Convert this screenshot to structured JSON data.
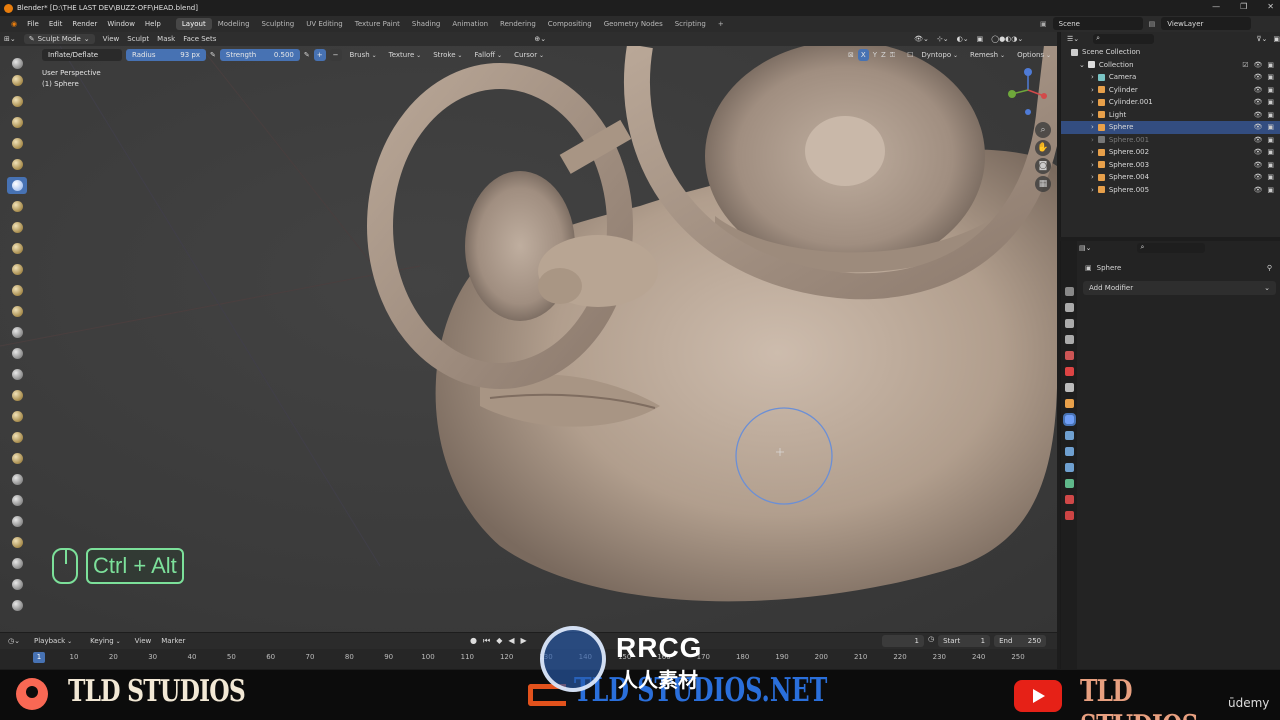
{
  "window": {
    "title": "Blender* [D:\\THE LAST DEV\\BUZZ-OFF\\HEAD.blend]",
    "controls": [
      "—",
      "❐",
      "✕"
    ]
  },
  "menu": [
    "File",
    "Edit",
    "Render",
    "Window",
    "Help"
  ],
  "workspaces": [
    "Layout",
    "Modeling",
    "Sculpting",
    "UV Editing",
    "Texture Paint",
    "Shading",
    "Animation",
    "Rendering",
    "Compositing",
    "Geometry Nodes",
    "Scripting"
  ],
  "scene": {
    "name": "Scene",
    "view_layer": "ViewLayer"
  },
  "header": {
    "mode": "Sculpt Mode",
    "items": [
      "View",
      "Sculpt",
      "Mask",
      "Face Sets"
    ]
  },
  "brush": {
    "name": "Inflate/Deflate",
    "radius_label": "Radius",
    "radius_value": "93 px",
    "strength_label": "Strength",
    "strength_value": "0.500",
    "menus": [
      "Brush",
      "Texture",
      "Stroke",
      "Falloff",
      "Cursor"
    ],
    "right_menus": [
      "Dyntopo",
      "Remesh",
      "Options"
    ],
    "axes": [
      "X",
      "Y",
      "Z"
    ]
  },
  "viewport": {
    "perspective": "User Perspective",
    "object": "(1) Sphere"
  },
  "keycast": {
    "keys": "Ctrl + Alt"
  },
  "outliner": {
    "root": "Scene Collection",
    "collection": "Collection",
    "items": [
      {
        "name": "Camera",
        "color": "#7ac4c4"
      },
      {
        "name": "Cylinder",
        "color": "#e8a04a"
      },
      {
        "name": "Cylinder.001",
        "color": "#e8a04a"
      },
      {
        "name": "Light",
        "color": "#e8a04a"
      },
      {
        "name": "Sphere",
        "color": "#e8a04a",
        "selected": true
      },
      {
        "name": "Sphere.001",
        "color": "#777777",
        "dim": true
      },
      {
        "name": "Sphere.002",
        "color": "#e8a04a"
      },
      {
        "name": "Sphere.003",
        "color": "#e8a04a"
      },
      {
        "name": "Sphere.004",
        "color": "#e8a04a"
      },
      {
        "name": "Sphere.005",
        "color": "#e8a04a"
      }
    ]
  },
  "properties": {
    "object": "Sphere",
    "add_modifier": "Add Modifier"
  },
  "timeline": {
    "menus": [
      "Playback",
      "Keying",
      "View",
      "Marker"
    ],
    "current_frame": "1",
    "start_label": "Start",
    "start": "1",
    "end_label": "End",
    "end": "250",
    "ticks": [
      "10",
      "20",
      "30",
      "40",
      "50",
      "60",
      "70",
      "80",
      "90",
      "100",
      "110",
      "120",
      "130",
      "140",
      "150",
      "160",
      "170",
      "180",
      "190",
      "200",
      "210",
      "220",
      "230",
      "240",
      "250"
    ]
  },
  "branding": {
    "left": "TLD STUDIOS",
    "center": "TLD STUDIOS.NET",
    "right": "TLD STUDIOS",
    "watermark": "RRCG",
    "watermark_sub": "人人素材",
    "udemy": "ūdemy"
  },
  "colors": {
    "accent": "#4772b3",
    "keycast": "#7ce09a",
    "patreon": "#f96854",
    "youtube": "#e62117"
  }
}
